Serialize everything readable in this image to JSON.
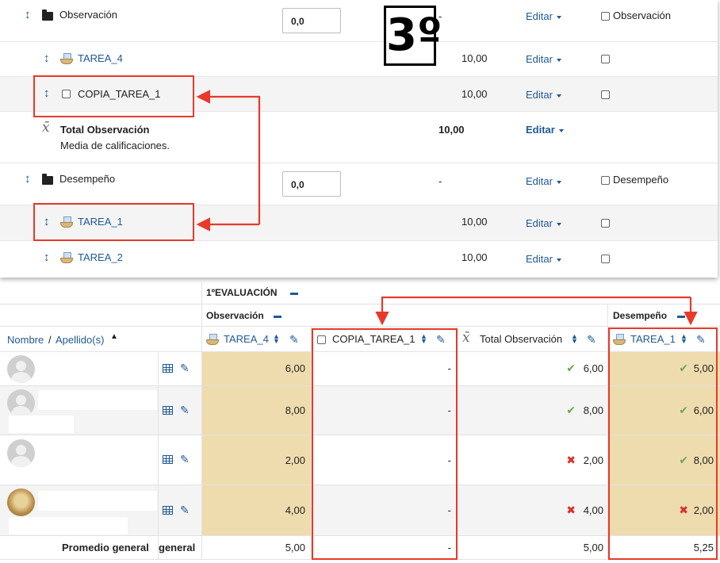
{
  "setup": {
    "badge": "3º",
    "rows": [
      {
        "kind": "category",
        "name": "Observación",
        "input": "0,0",
        "value": "-",
        "action": "Editar",
        "check_label": "Observación"
      },
      {
        "kind": "item",
        "name": "TAREA_4",
        "value": "10,00",
        "action": "Editar"
      },
      {
        "kind": "item",
        "name": "COPIA_TAREA_1",
        "value": "10,00",
        "action": "Editar"
      },
      {
        "kind": "total",
        "name": "Total Observación",
        "sub": "Media de calificaciones.",
        "value": "10,00",
        "action": "Editar"
      },
      {
        "kind": "category",
        "name": "Desempeño",
        "input": "0,0",
        "value": "-",
        "action": "Editar",
        "check_label": "Desempeño"
      },
      {
        "kind": "item",
        "name": "TAREA_1",
        "value": "10,00",
        "action": "Editar"
      },
      {
        "kind": "item",
        "name": "TAREA_2",
        "value": "10,00",
        "action": "Editar"
      }
    ]
  },
  "grader": {
    "period": "1ºEVALUACIÓN",
    "cat_observacion": "Observación",
    "cat_desempeno": "Desempeño",
    "name_sort": {
      "nombre": "Nombre",
      "sep": " / ",
      "apellido": "Apellido(s)"
    },
    "columns": [
      "TAREA_4",
      "COPIA_TAREA_1",
      "Total Observación",
      "TAREA_1"
    ],
    "students": [
      {
        "tarea4": "6,00",
        "copia": "-",
        "total": "6,00",
        "total_ok": true,
        "tarea1": "5,00",
        "tarea1_ok": true
      },
      {
        "tarea4": "8,00",
        "copia": "-",
        "total": "8,00",
        "total_ok": true,
        "tarea1": "6,00",
        "tarea1_ok": true
      },
      {
        "tarea4": "2,00",
        "copia": "-",
        "total": "2,00",
        "total_ok": false,
        "tarea1": "8,00",
        "tarea1_ok": true
      },
      {
        "tarea4": "4,00",
        "copia": "-",
        "total": "4,00",
        "total_ok": false,
        "tarea1": "2,00",
        "tarea1_ok": false
      }
    ],
    "average": {
      "label": "Promedio general",
      "label2": "general",
      "tarea4": "5,00",
      "copia": "-",
      "total": "5,00",
      "tarea1": "5,25"
    }
  },
  "icons": {
    "move": "move-arrows-icon",
    "folder": "folder-icon",
    "assignment": "assignment-icon",
    "sigma": "x-bar-mean-icon",
    "grid": "grid-icon",
    "pencil": "pencil-icon"
  },
  "colors": {
    "link": "#1f5a94",
    "highlight": "#e8392a",
    "tan": "#efdcae",
    "pass": "#6aa84f",
    "fail": "#d9302c"
  }
}
